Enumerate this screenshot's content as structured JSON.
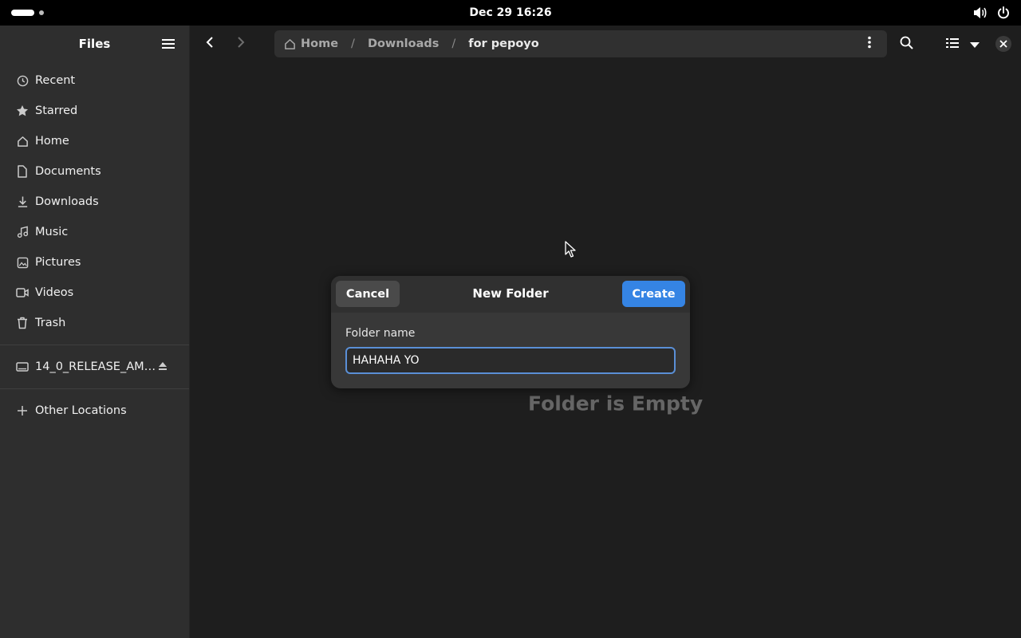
{
  "topbar": {
    "datetime": "Dec 29  16:26"
  },
  "sidebar": {
    "title": "Files",
    "places": [
      {
        "label": "Recent",
        "icon": "clock-icon"
      },
      {
        "label": "Starred",
        "icon": "star-icon"
      },
      {
        "label": "Home",
        "icon": "home-icon"
      },
      {
        "label": "Documents",
        "icon": "document-icon"
      },
      {
        "label": "Downloads",
        "icon": "download-icon"
      },
      {
        "label": "Music",
        "icon": "music-icon"
      },
      {
        "label": "Pictures",
        "icon": "picture-icon"
      },
      {
        "label": "Videos",
        "icon": "video-icon"
      },
      {
        "label": "Trash",
        "icon": "trash-icon"
      }
    ],
    "drive": {
      "label": "14_0_RELEASE_AM…",
      "icon": "drive-icon"
    },
    "other_locations": {
      "label": "Other Locations",
      "icon": "plus-icon"
    }
  },
  "pathbar": {
    "crumbs": [
      "Home",
      "Downloads",
      "for pepoyo"
    ]
  },
  "content": {
    "empty_text": "Folder is Empty"
  },
  "dialog": {
    "title": "New Folder",
    "cancel_label": "Cancel",
    "create_label": "Create",
    "field_label": "Folder name",
    "field_value": "HAHAHA YO"
  },
  "colors": {
    "accent": "#3584e4",
    "sidebar_bg": "#2e2e2e",
    "content_bg": "#1e1e1e",
    "dialog_bg": "#383838"
  }
}
